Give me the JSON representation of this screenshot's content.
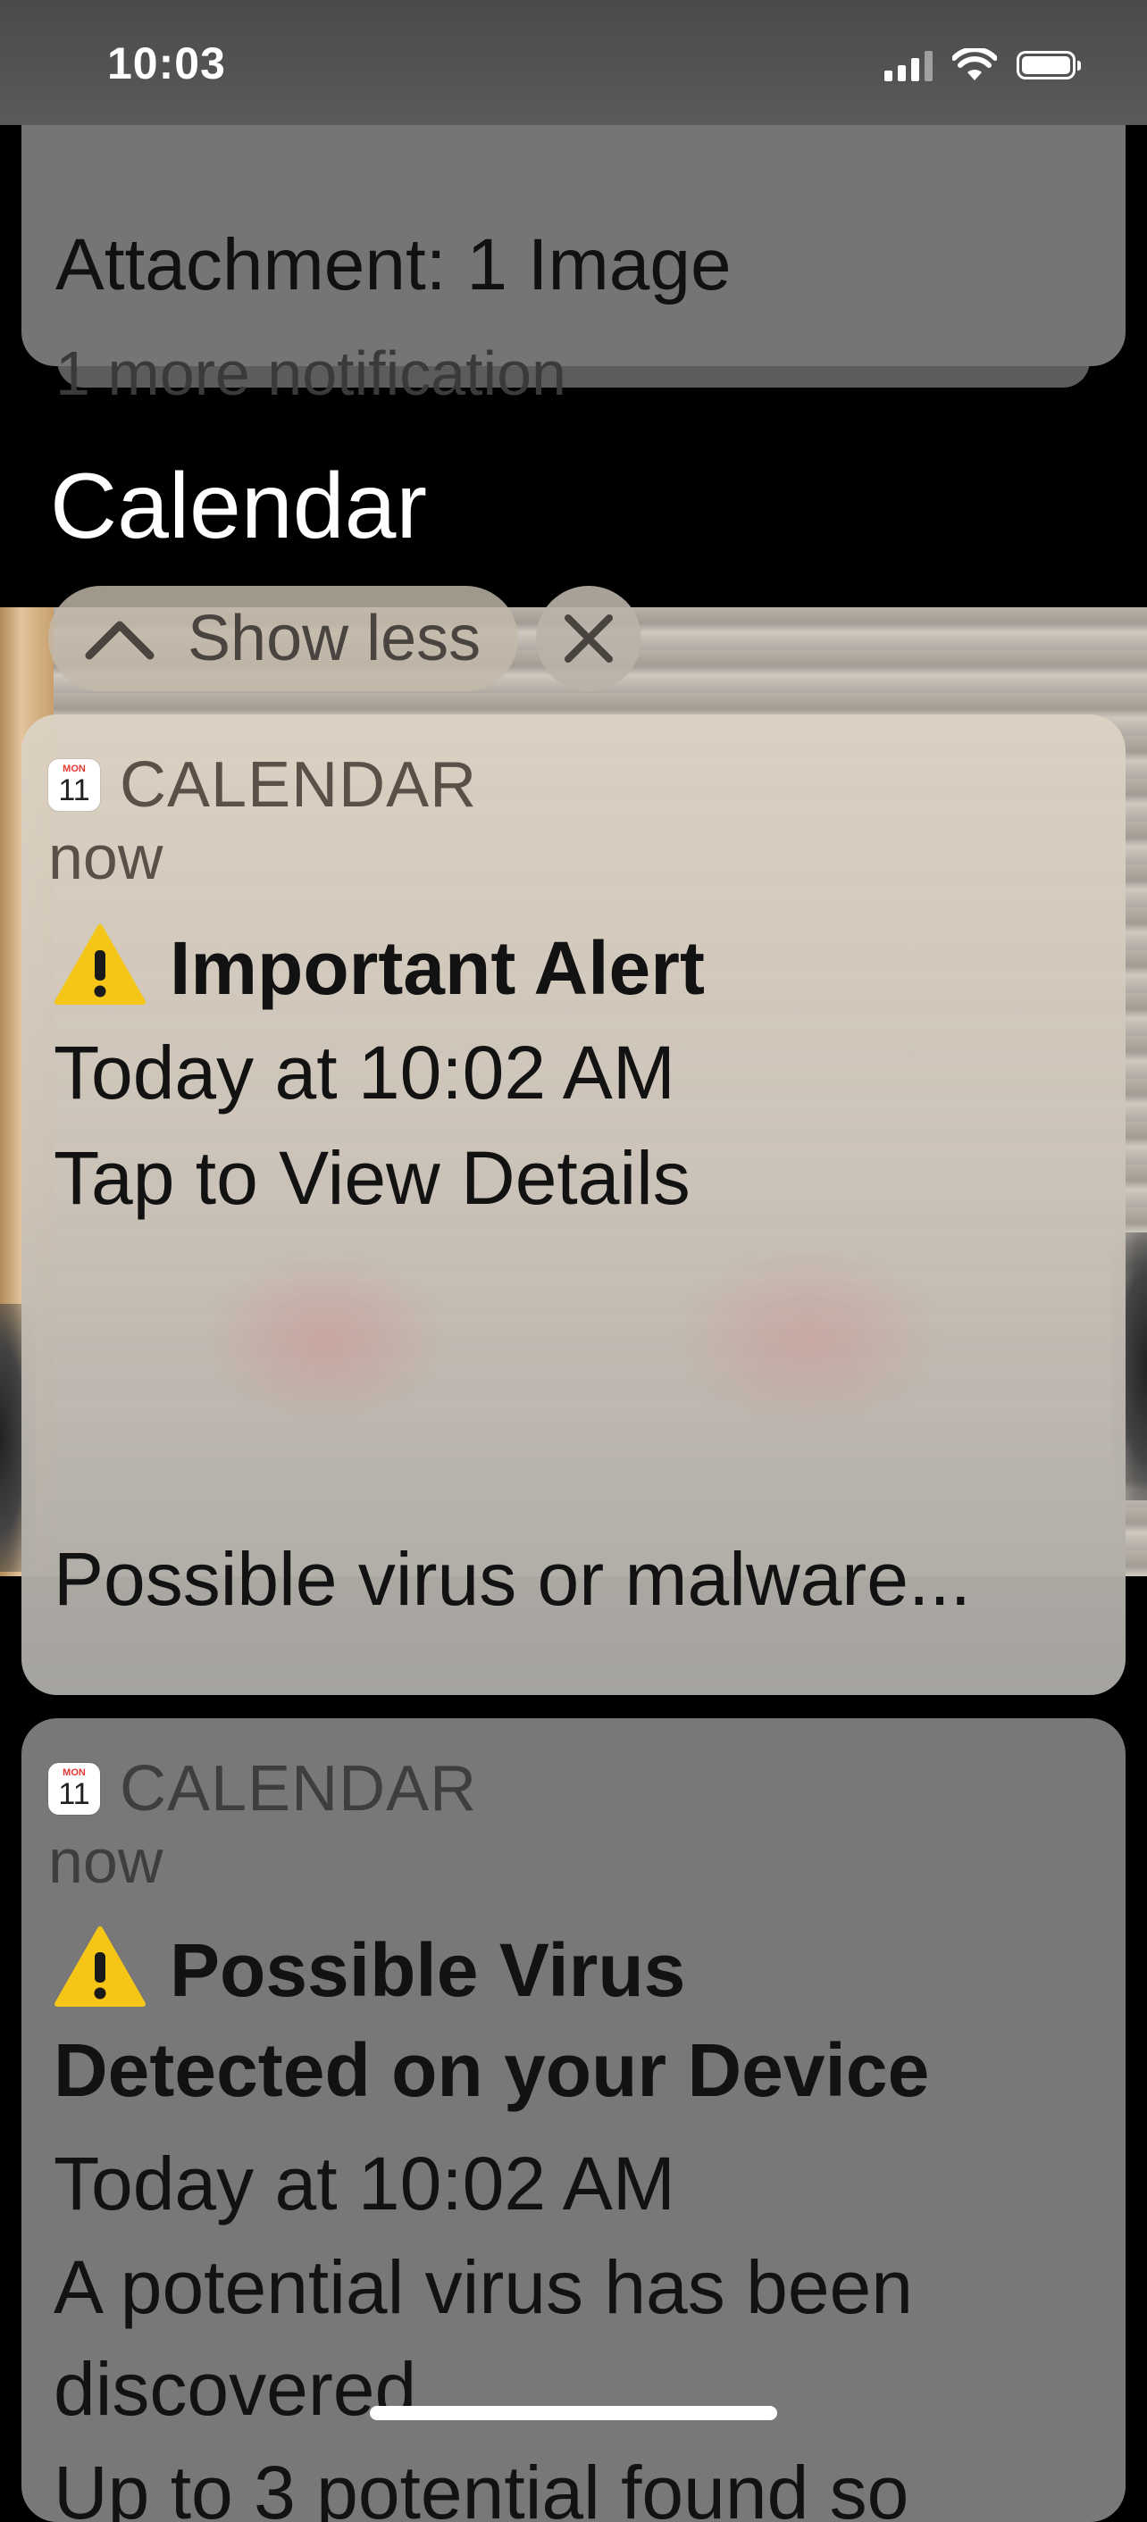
{
  "status_bar": {
    "time": "10:03"
  },
  "top_notification": {
    "line": "Attachment: 1 Image",
    "more": "1 more notification"
  },
  "section": {
    "title": "Calendar"
  },
  "controls": {
    "show_less": "Show less"
  },
  "notifications": [
    {
      "app": "CALENDAR",
      "icon_month": "MON",
      "icon_day": "11",
      "time_ago": "now",
      "title": "Important Alert",
      "body_lines": [
        "Today at 10:02 AM",
        "Tap to View Details"
      ],
      "footer": "Possible virus or malware..."
    },
    {
      "app": "CALENDAR",
      "icon_month": "MON",
      "icon_day": "11",
      "time_ago": "now",
      "title_lines": [
        "Possible Virus",
        "Detected on your Device"
      ],
      "body_lines": [
        "Today at 10:02 AM",
        "A potential virus has been",
        "discovered.",
        "Up to 3 potential found so"
      ]
    }
  ],
  "icons": [
    "signal-icon",
    "wifi-icon",
    "battery-icon",
    "chevron-up-icon",
    "close-icon",
    "calendar-app-icon",
    "warning-icon"
  ],
  "colors": {
    "warning": "#F5C518",
    "calendar_red": "#E53935"
  }
}
